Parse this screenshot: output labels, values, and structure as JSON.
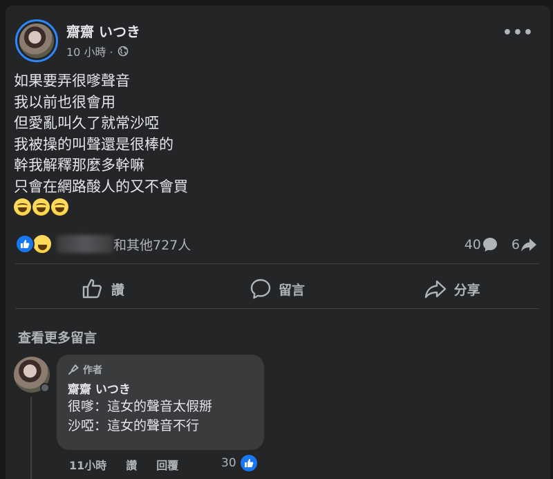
{
  "post": {
    "author": "齋齋 いつき",
    "time": "10 小時 ·",
    "privacy_icon": "globe-icon",
    "more_icon": "•••",
    "lines": [
      "如果要弄很嗲聲音",
      "我以前也很會用",
      "但愛亂叫久了就常沙啞",
      "我被操的叫聲還是很棒的",
      "幹我解釋那麼多幹嘛",
      "只會在網路酸人的又不會買"
    ],
    "emojis": [
      "laughing-emoji",
      "laughing-emoji",
      "laughing-emoji"
    ]
  },
  "reactions": {
    "others_text": "和其他727人",
    "comment_count": "40",
    "share_count": "6"
  },
  "actions": {
    "like": "讚",
    "comment": "留言",
    "share": "分享"
  },
  "comments": {
    "view_more": "查看更多留言",
    "items": [
      {
        "badge": "作者",
        "name": "齋齋 いつき",
        "lines": [
          "很嗲：這女的聲音太假掰",
          "沙啞：這女的聲音不行"
        ],
        "time": "11小時",
        "like": "讚",
        "reply": "回覆",
        "like_count": "30"
      }
    ]
  },
  "colors": {
    "background": "#18191a",
    "card": "#242526",
    "accent": "#1877f2",
    "avatar_ring": "#2d88ff"
  }
}
